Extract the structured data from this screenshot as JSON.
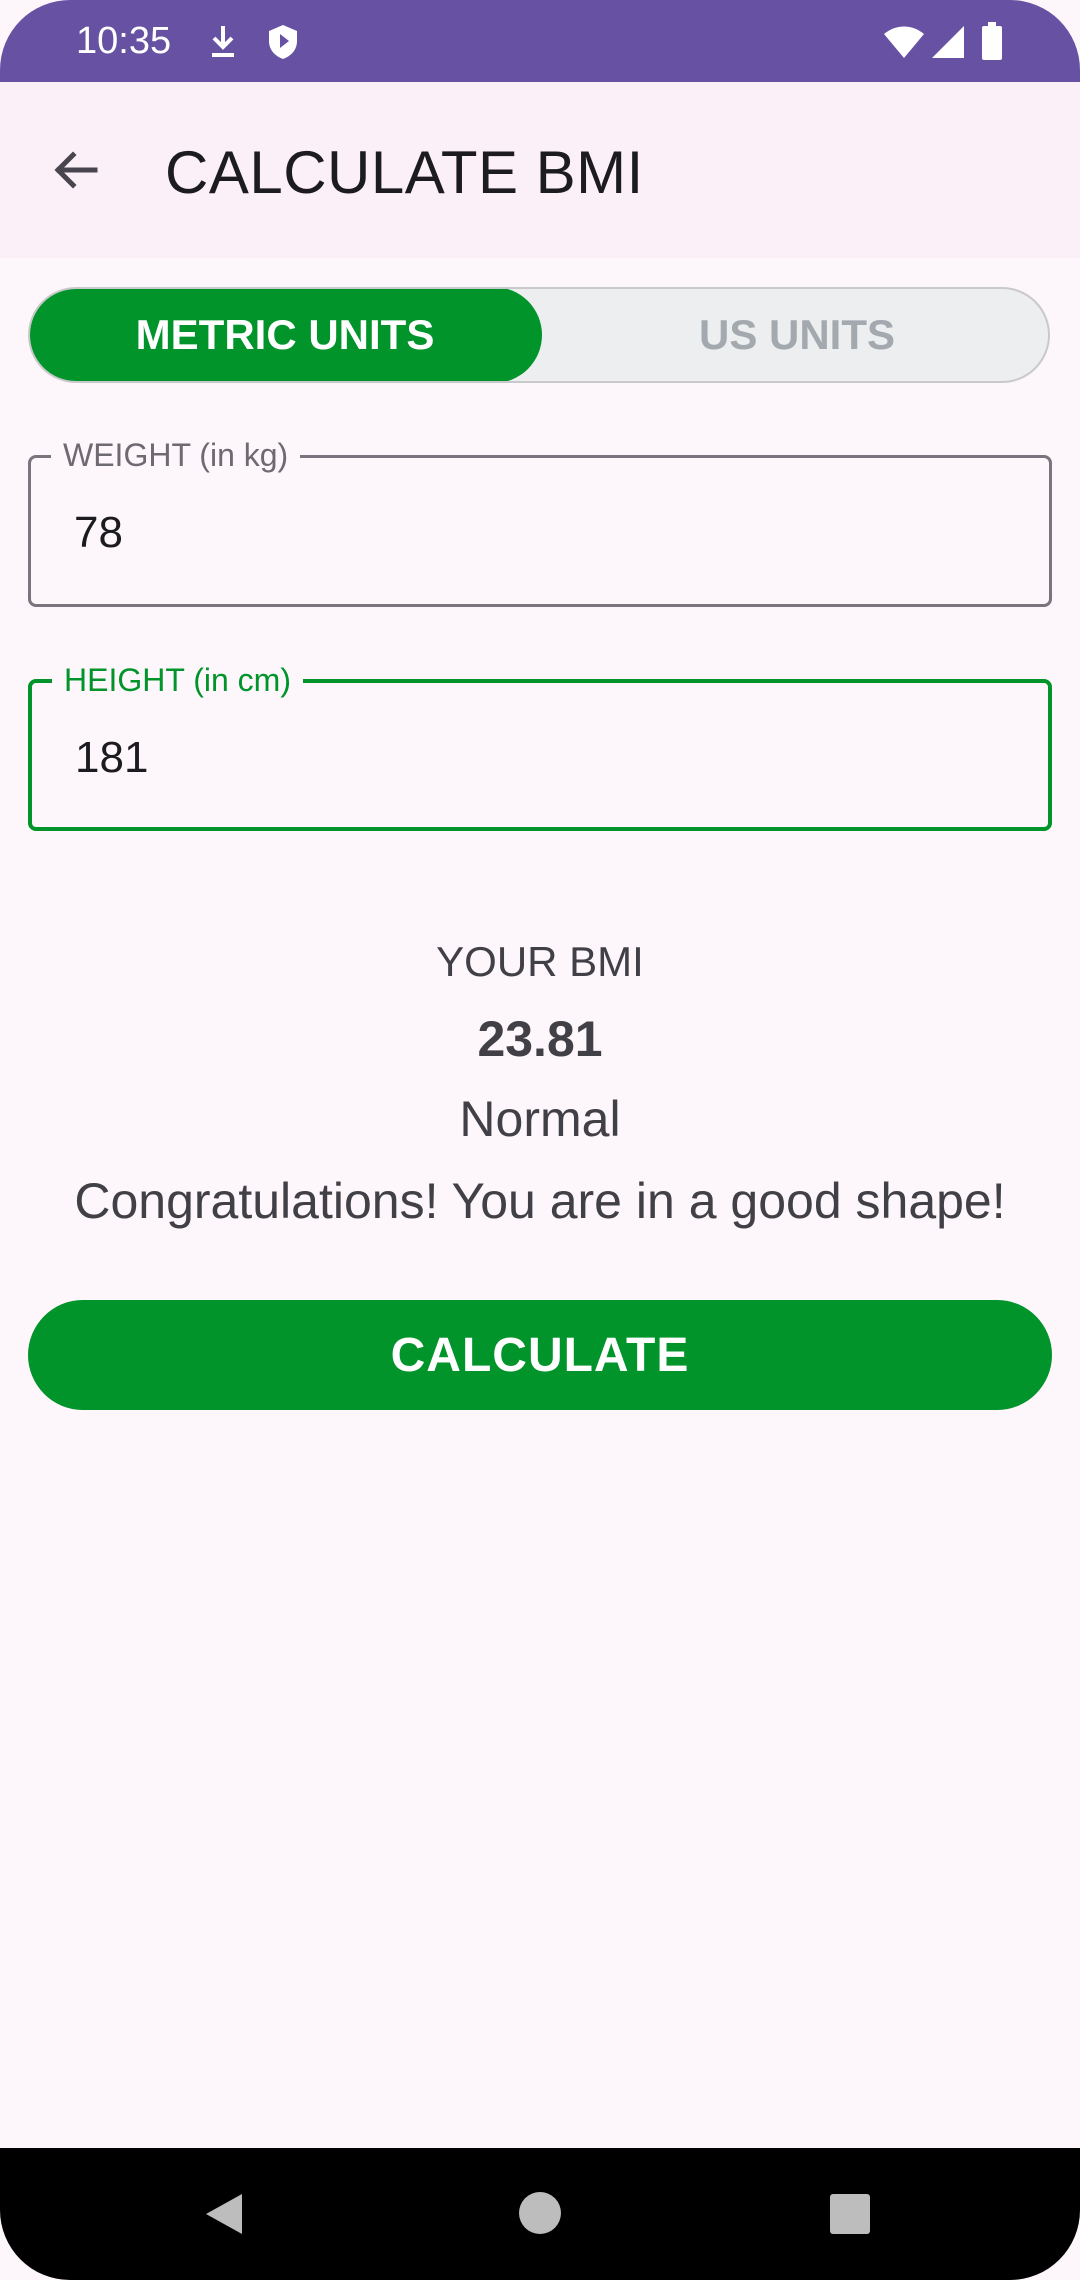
{
  "status_bar": {
    "time": "10:35",
    "icons": [
      "download-icon",
      "shield-icon",
      "wifi-icon",
      "signal-icon",
      "battery-icon"
    ]
  },
  "app_bar": {
    "title": "CALCULATE BMI",
    "back_icon": "arrow-back-icon"
  },
  "units_toggle": {
    "metric_label": "METRIC UNITS",
    "us_label": "US UNITS",
    "selected": "METRIC UNITS"
  },
  "form": {
    "weight": {
      "label": "WEIGHT (in kg)",
      "value": "78"
    },
    "height": {
      "label": "HEIGHT (in cm)",
      "value": "181"
    }
  },
  "result": {
    "label": "YOUR BMI",
    "value": "23.81",
    "category": "Normal",
    "message": "Congratulations! You are in a good shape!"
  },
  "calculate_button": {
    "label": "CALCULATE"
  },
  "nav_bar": {
    "icons": [
      "nav-back-icon",
      "nav-home-icon",
      "nav-recents-icon"
    ]
  },
  "colors": {
    "accent": "#00942a",
    "status_bar": "#6751a3",
    "background": "#fdf6fb",
    "app_bar": "#fcf0f8"
  }
}
